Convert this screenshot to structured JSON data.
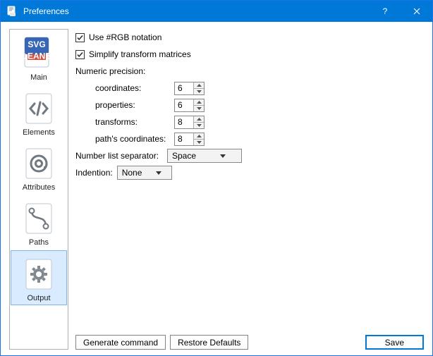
{
  "window": {
    "title": "Preferences"
  },
  "sidebar": {
    "items": [
      {
        "label": "Main"
      },
      {
        "label": "Elements"
      },
      {
        "label": "Attributes"
      },
      {
        "label": "Paths"
      },
      {
        "label": "Output"
      }
    ]
  },
  "form": {
    "use_rgb_label": "Use #RGB notation",
    "simplify_label": "Simplify transform matrices",
    "numeric_precision_label": "Numeric precision:",
    "coordinates_label": "coordinates:",
    "coordinates_value": "6",
    "properties_label": "properties:",
    "properties_value": "6",
    "transforms_label": "transforms:",
    "transforms_value": "8",
    "paths_coords_label": "path's coordinates:",
    "paths_coords_value": "8",
    "number_sep_label": "Number list separator:",
    "number_sep_value": "Space",
    "indention_label": "Indention:",
    "indention_value": "None"
  },
  "buttons": {
    "generate": "Generate command",
    "restore": "Restore Defaults",
    "save": "Save"
  }
}
